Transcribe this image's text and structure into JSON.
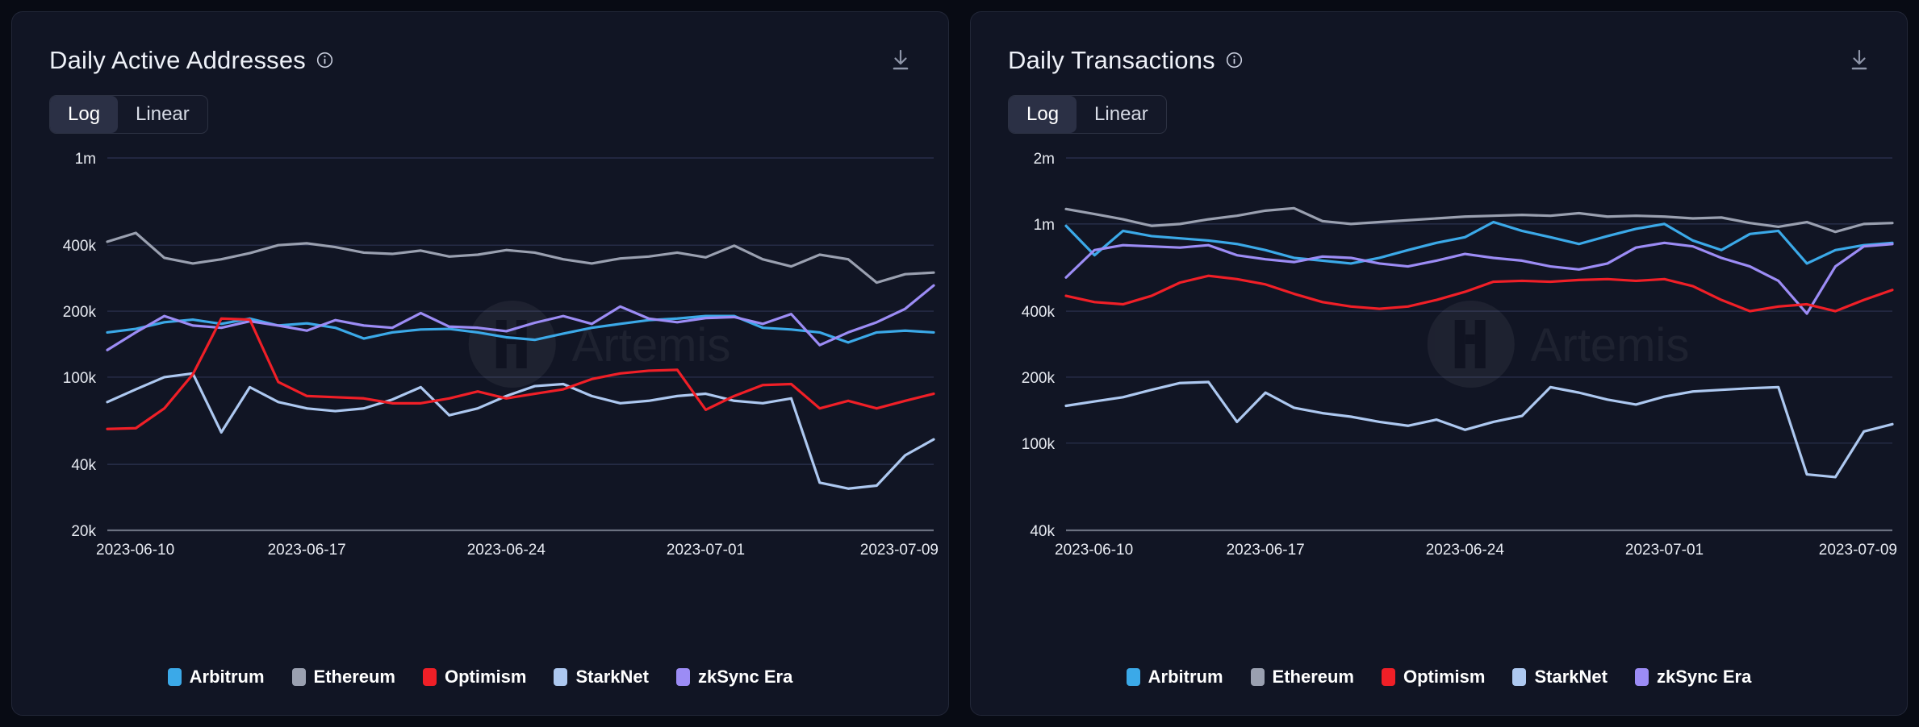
{
  "theme": {
    "page_bg": "#080b14",
    "card_bg": "#111524",
    "card_border": "#222738",
    "grid": "#2c3350",
    "axis_text": "#e8ebf2",
    "title_text": "#eef1f8"
  },
  "series_colors": {
    "Arbitrum": "#3ba9e8",
    "Ethereum": "#9aa0b0",
    "Optimism": "#f01f27",
    "StarkNet": "#adc8f0",
    "zkSync Era": "#9c8cf5"
  },
  "legend": [
    {
      "label": "Arbitrum",
      "color": "#3ba9e8",
      "swatch_name": "legend-swatch-arbitrum"
    },
    {
      "label": "Ethereum",
      "color": "#9aa0b0",
      "swatch_name": "legend-swatch-ethereum"
    },
    {
      "label": "Optimism",
      "color": "#f01f27",
      "swatch_name": "legend-swatch-optimism"
    },
    {
      "label": "StarkNet",
      "color": "#adc8f0",
      "swatch_name": "legend-swatch-starknet"
    },
    {
      "label": "zkSync Era",
      "color": "#9c8cf5",
      "swatch_name": "legend-swatch-zksync-era"
    }
  ],
  "watermark": {
    "text": "Artemis",
    "logo_icon": "artemis-logo-icon"
  },
  "cards": [
    {
      "title": "Daily Active Addresses",
      "info_icon": "info-circle-icon",
      "download_icon": "download-icon",
      "scale_toggle": {
        "options": [
          "Log",
          "Linear"
        ],
        "selected": "Log"
      }
    },
    {
      "title": "Daily Transactions",
      "info_icon": "info-circle-icon",
      "download_icon": "download-icon",
      "scale_toggle": {
        "options": [
          "Log",
          "Linear"
        ],
        "selected": "Log"
      }
    }
  ],
  "chart_data": [
    {
      "type": "line",
      "title": "Daily Active Addresses",
      "xlabel": "",
      "ylabel": "",
      "yscale": "log",
      "grid": true,
      "legend_position": "bottom",
      "ylim": [
        20000,
        1000000
      ],
      "ytick_labels": [
        "1m",
        "400k",
        "200k",
        "100k",
        "40k",
        "20k"
      ],
      "ytick_values": [
        1000000,
        400000,
        200000,
        100000,
        40000,
        20000
      ],
      "xtick_labels": [
        "2023-06-10",
        "2023-06-17",
        "2023-06-24",
        "2023-07-01",
        "2023-07-09"
      ],
      "xtick_indices": [
        0,
        7,
        14,
        21,
        29
      ],
      "x": [
        "2023-06-10",
        "2023-06-11",
        "2023-06-12",
        "2023-06-13",
        "2023-06-14",
        "2023-06-15",
        "2023-06-16",
        "2023-06-17",
        "2023-06-18",
        "2023-06-19",
        "2023-06-20",
        "2023-06-21",
        "2023-06-22",
        "2023-06-23",
        "2023-06-24",
        "2023-06-25",
        "2023-06-26",
        "2023-06-27",
        "2023-06-28",
        "2023-06-29",
        "2023-06-30",
        "2023-07-01",
        "2023-07-02",
        "2023-07-03",
        "2023-07-04",
        "2023-07-05",
        "2023-07-06",
        "2023-07-07",
        "2023-07-08",
        "2023-07-09"
      ],
      "series": [
        {
          "name": "Arbitrum",
          "color": "#3ba9e8",
          "values": [
            160000,
            166000,
            178000,
            183000,
            175000,
            185000,
            172000,
            176000,
            168000,
            150000,
            160000,
            165000,
            166000,
            160000,
            152000,
            148000,
            158000,
            168000,
            175000,
            182000,
            185000,
            190000,
            190000,
            168000,
            165000,
            160000,
            144000,
            160000,
            163000,
            160000
          ]
        },
        {
          "name": "Ethereum",
          "color": "#9aa0b0",
          "values": [
            415000,
            455000,
            350000,
            330000,
            345000,
            368000,
            400000,
            408000,
            392000,
            370000,
            365000,
            378000,
            355000,
            362000,
            380000,
            370000,
            345000,
            330000,
            348000,
            355000,
            370000,
            352000,
            398000,
            345000,
            320000,
            362000,
            345000,
            270000,
            295000,
            300000
          ]
        },
        {
          "name": "Optimism",
          "color": "#f01f27",
          "values": [
            58000,
            58500,
            72000,
            103000,
            185000,
            183000,
            95000,
            82000,
            81000,
            80000,
            76000,
            76000,
            80000,
            86000,
            80000,
            84000,
            88000,
            98000,
            104000,
            107000,
            108000,
            71000,
            82000,
            92000,
            93000,
            72000,
            78000,
            72000,
            78000,
            84000
          ]
        },
        {
          "name": "StarkNet",
          "color": "#adc8f0",
          "values": [
            77000,
            88000,
            100000,
            104000,
            56000,
            90000,
            77000,
            72000,
            70000,
            72000,
            79000,
            90000,
            67000,
            72000,
            82000,
            91000,
            93000,
            82000,
            76000,
            78000,
            82000,
            84000,
            78000,
            76000,
            80000,
            33000,
            31000,
            32000,
            44000,
            52000
          ]
        },
        {
          "name": "zkSync Era",
          "color": "#9c8cf5",
          "values": [
            133000,
            160000,
            190000,
            172000,
            168000,
            180000,
            172000,
            163000,
            182000,
            172000,
            168000,
            196000,
            170000,
            168000,
            162000,
            177000,
            190000,
            175000,
            210000,
            185000,
            178000,
            186000,
            188000,
            175000,
            194000,
            140000,
            160000,
            178000,
            205000,
            262000
          ]
        }
      ]
    },
    {
      "type": "line",
      "title": "Daily Transactions",
      "xlabel": "",
      "ylabel": "",
      "yscale": "log",
      "grid": true,
      "legend_position": "bottom",
      "ylim": [
        40000,
        2000000
      ],
      "ytick_labels": [
        "2m",
        "1m",
        "400k",
        "200k",
        "100k",
        "40k"
      ],
      "ytick_values": [
        2000000,
        1000000,
        400000,
        200000,
        100000,
        40000
      ],
      "xtick_labels": [
        "2023-06-10",
        "2023-06-17",
        "2023-06-24",
        "2023-07-01",
        "2023-07-09"
      ],
      "xtick_indices": [
        0,
        7,
        14,
        21,
        29
      ],
      "x": [
        "2023-06-10",
        "2023-06-11",
        "2023-06-12",
        "2023-06-13",
        "2023-06-14",
        "2023-06-15",
        "2023-06-16",
        "2023-06-17",
        "2023-06-18",
        "2023-06-19",
        "2023-06-20",
        "2023-06-21",
        "2023-06-22",
        "2023-06-23",
        "2023-06-24",
        "2023-06-25",
        "2023-06-26",
        "2023-06-27",
        "2023-06-28",
        "2023-06-29",
        "2023-06-30",
        "2023-07-01",
        "2023-07-02",
        "2023-07-03",
        "2023-07-04",
        "2023-07-05",
        "2023-07-06",
        "2023-07-07",
        "2023-07-08",
        "2023-07-09"
      ],
      "series": [
        {
          "name": "Arbitrum",
          "color": "#3ba9e8",
          "values": [
            980000,
            720000,
            930000,
            880000,
            860000,
            840000,
            810000,
            760000,
            700000,
            680000,
            660000,
            700000,
            760000,
            820000,
            870000,
            1020000,
            930000,
            870000,
            810000,
            880000,
            950000,
            1000000,
            840000,
            760000,
            900000,
            930000,
            660000,
            760000,
            800000,
            820000
          ]
        },
        {
          "name": "Ethereum",
          "color": "#9aa0b0",
          "values": [
            1170000,
            1110000,
            1050000,
            980000,
            1000000,
            1050000,
            1090000,
            1150000,
            1180000,
            1030000,
            1000000,
            1020000,
            1040000,
            1060000,
            1080000,
            1090000,
            1100000,
            1090000,
            1120000,
            1080000,
            1090000,
            1080000,
            1060000,
            1070000,
            1010000,
            970000,
            1020000,
            920000,
            1000000,
            1010000
          ]
        },
        {
          "name": "Optimism",
          "color": "#f01f27",
          "values": [
            470000,
            440000,
            430000,
            470000,
            540000,
            580000,
            560000,
            530000,
            480000,
            440000,
            420000,
            410000,
            420000,
            450000,
            490000,
            545000,
            550000,
            545000,
            555000,
            560000,
            550000,
            560000,
            520000,
            450000,
            400000,
            420000,
            430000,
            400000,
            450000,
            500000
          ]
        },
        {
          "name": "StarkNet",
          "color": "#adc8f0",
          "values": [
            148000,
            155000,
            162000,
            175000,
            188000,
            190000,
            125000,
            170000,
            145000,
            137000,
            132000,
            125000,
            120000,
            128000,
            115000,
            125000,
            133000,
            180000,
            170000,
            158000,
            150000,
            163000,
            172000,
            175000,
            178000,
            180000,
            72000,
            70000,
            113000,
            122000
          ]
        },
        {
          "name": "zkSync Era",
          "color": "#9c8cf5",
          "values": [
            570000,
            760000,
            800000,
            790000,
            780000,
            800000,
            720000,
            690000,
            670000,
            710000,
            700000,
            660000,
            640000,
            680000,
            730000,
            700000,
            680000,
            640000,
            620000,
            660000,
            780000,
            820000,
            790000,
            700000,
            640000,
            550000,
            390000,
            640000,
            790000,
            810000
          ]
        }
      ]
    }
  ]
}
